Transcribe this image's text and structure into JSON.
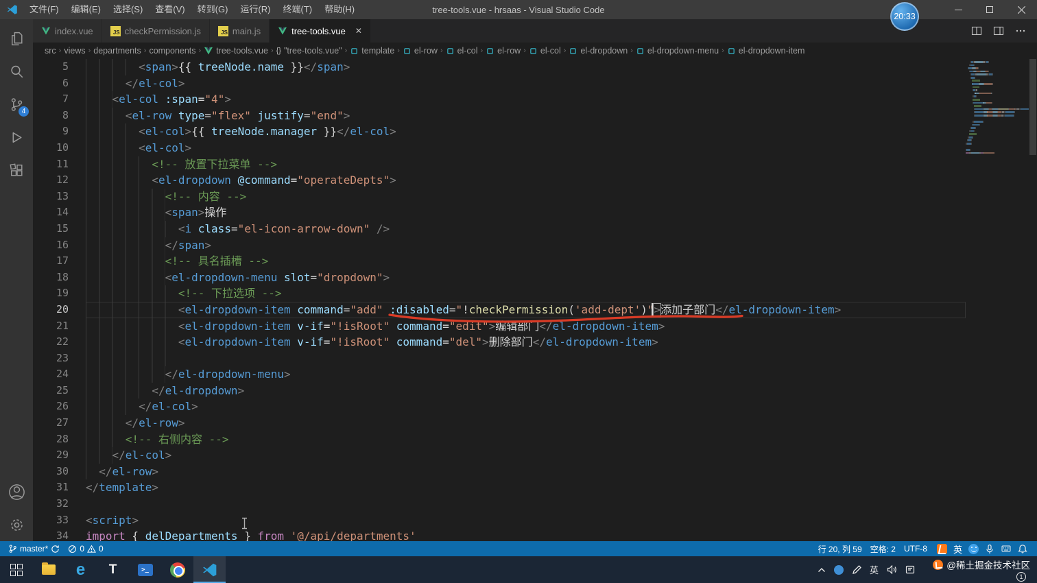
{
  "theme": {
    "titlebar": "#3c3c3c",
    "statusbar": "#0e6bab",
    "taskbar": "#1b2635",
    "tag": "#569cd6",
    "attr": "#9cdcfe",
    "string": "#ce9178",
    "comment": "#6a9955",
    "punct": "#808080",
    "keyword": "#c586c0",
    "func": "#dcdcaa",
    "text": "#d4d4d4",
    "annotation": "#d93b26"
  },
  "title_bar": {
    "menus": [
      "文件(F)",
      "编辑(E)",
      "选择(S)",
      "查看(V)",
      "转到(G)",
      "运行(R)",
      "终端(T)",
      "帮助(H)"
    ],
    "title": "tree-tools.vue - hrsaas - Visual Studio Code",
    "clock": "20:33"
  },
  "activity_bar": {
    "icons": [
      "files",
      "search",
      "source-control",
      "run-debug",
      "extensions"
    ],
    "bottom_icons": [
      "account",
      "settings"
    ],
    "source_control_badge": "4"
  },
  "tabs": [
    {
      "label": "index.vue",
      "icon": "vue",
      "active": false
    },
    {
      "label": "checkPermission.js",
      "icon": "js",
      "active": false
    },
    {
      "label": "main.js",
      "icon": "js",
      "active": false
    },
    {
      "label": "tree-tools.vue",
      "icon": "vue",
      "active": true,
      "close_glyph": "✕"
    }
  ],
  "breadcrumbs": [
    {
      "label": "src",
      "icon": ""
    },
    {
      "label": "views",
      "icon": ""
    },
    {
      "label": "departments",
      "icon": ""
    },
    {
      "label": "components",
      "icon": ""
    },
    {
      "label": "tree-tools.vue",
      "icon": "vue"
    },
    {
      "label": "\"tree-tools.vue\"",
      "icon": "braces"
    },
    {
      "label": "template",
      "icon": "element"
    },
    {
      "label": "el-row",
      "icon": "element"
    },
    {
      "label": "el-col",
      "icon": "element"
    },
    {
      "label": "el-row",
      "icon": "element"
    },
    {
      "label": "el-col",
      "icon": "element"
    },
    {
      "label": "el-dropdown",
      "icon": "element"
    },
    {
      "label": "el-dropdown-menu",
      "icon": "element"
    },
    {
      "label": "el-dropdown-item",
      "icon": "element"
    }
  ],
  "editor": {
    "lines": [
      {
        "n": 5,
        "ind": 8,
        "tk": [
          [
            "p",
            "<"
          ],
          [
            "t",
            "span"
          ],
          [
            "p",
            ">"
          ],
          [
            "x",
            "{{ "
          ],
          [
            "v",
            "treeNode.name"
          ],
          [
            "x",
            " }}"
          ],
          [
            "p",
            "</"
          ],
          [
            "t",
            "span"
          ],
          [
            "p",
            ">"
          ]
        ]
      },
      {
        "n": 6,
        "ind": 6,
        "tk": [
          [
            "p",
            "</"
          ],
          [
            "t",
            "el-col"
          ],
          [
            "p",
            ">"
          ]
        ]
      },
      {
        "n": 7,
        "ind": 4,
        "tk": [
          [
            "p",
            "<"
          ],
          [
            "t",
            "el-col"
          ],
          [
            "x",
            " "
          ],
          [
            "a",
            ":span"
          ],
          [
            "x",
            "="
          ],
          [
            "s",
            "\"4\""
          ],
          [
            "p",
            ">"
          ]
        ]
      },
      {
        "n": 8,
        "ind": 6,
        "tk": [
          [
            "p",
            "<"
          ],
          [
            "t",
            "el-row"
          ],
          [
            "x",
            " "
          ],
          [
            "a",
            "type"
          ],
          [
            "x",
            "="
          ],
          [
            "s",
            "\"flex\""
          ],
          [
            "x",
            " "
          ],
          [
            "a",
            "justify"
          ],
          [
            "x",
            "="
          ],
          [
            "s",
            "\"end\""
          ],
          [
            "p",
            ">"
          ]
        ]
      },
      {
        "n": 9,
        "ind": 8,
        "tk": [
          [
            "p",
            "<"
          ],
          [
            "t",
            "el-col"
          ],
          [
            "p",
            ">"
          ],
          [
            "x",
            "{{ "
          ],
          [
            "v",
            "treeNode.manager"
          ],
          [
            "x",
            " }}"
          ],
          [
            "p",
            "</"
          ],
          [
            "t",
            "el-col"
          ],
          [
            "p",
            ">"
          ]
        ]
      },
      {
        "n": 10,
        "ind": 8,
        "tk": [
          [
            "p",
            "<"
          ],
          [
            "t",
            "el-col"
          ],
          [
            "p",
            ">"
          ]
        ]
      },
      {
        "n": 11,
        "ind": 10,
        "tk": [
          [
            "c",
            "<!-- 放置下拉菜单 -->"
          ]
        ]
      },
      {
        "n": 12,
        "ind": 10,
        "tk": [
          [
            "p",
            "<"
          ],
          [
            "t",
            "el-dropdown"
          ],
          [
            "x",
            " "
          ],
          [
            "a",
            "@command"
          ],
          [
            "x",
            "="
          ],
          [
            "s",
            "\"operateDepts\""
          ],
          [
            "p",
            ">"
          ]
        ]
      },
      {
        "n": 13,
        "ind": 12,
        "tk": [
          [
            "c",
            "<!-- 内容 -->"
          ]
        ]
      },
      {
        "n": 14,
        "ind": 12,
        "tk": [
          [
            "p",
            "<"
          ],
          [
            "t",
            "span"
          ],
          [
            "p",
            ">"
          ],
          [
            "x",
            "操作"
          ]
        ]
      },
      {
        "n": 15,
        "ind": 14,
        "tk": [
          [
            "p",
            "<"
          ],
          [
            "t",
            "i"
          ],
          [
            "x",
            " "
          ],
          [
            "a",
            "class"
          ],
          [
            "x",
            "="
          ],
          [
            "s",
            "\"el-icon-arrow-down\""
          ],
          [
            "x",
            " "
          ],
          [
            "p",
            "/>"
          ]
        ]
      },
      {
        "n": 16,
        "ind": 12,
        "tk": [
          [
            "p",
            "</"
          ],
          [
            "t",
            "span"
          ],
          [
            "p",
            ">"
          ]
        ]
      },
      {
        "n": 17,
        "ind": 12,
        "tk": [
          [
            "c",
            "<!-- 具名插槽 -->"
          ]
        ]
      },
      {
        "n": 18,
        "ind": 12,
        "tk": [
          [
            "p",
            "<"
          ],
          [
            "t",
            "el-dropdown-menu"
          ],
          [
            "x",
            " "
          ],
          [
            "a",
            "slot"
          ],
          [
            "x",
            "="
          ],
          [
            "s",
            "\"dropdown\""
          ],
          [
            "p",
            ">"
          ]
        ]
      },
      {
        "n": 19,
        "ind": 14,
        "tk": [
          [
            "c",
            "<!-- 下拉选项 -->"
          ]
        ]
      },
      {
        "n": 20,
        "ind": 14,
        "cur": true,
        "tk": [
          [
            "p",
            "<"
          ],
          [
            "t",
            "el-dropdown-item"
          ],
          [
            "x",
            " "
          ],
          [
            "a",
            "command"
          ],
          [
            "x",
            "="
          ],
          [
            "s",
            "\"add\""
          ],
          [
            "x",
            " "
          ],
          [
            "a",
            ":disabled"
          ],
          [
            "x",
            "="
          ],
          [
            "s",
            "\""
          ],
          [
            "x",
            "!"
          ],
          [
            "f",
            "checkPermission"
          ],
          [
            "x",
            "("
          ],
          [
            "s",
            "'add-dept'"
          ],
          [
            "x",
            ")"
          ],
          [
            "s",
            "\""
          ],
          [
            "p",
            ">"
          ],
          [
            "x",
            "添加子部门"
          ],
          [
            "p",
            "</"
          ],
          [
            "t",
            "el-dropdown-item"
          ],
          [
            "p",
            ">"
          ]
        ]
      },
      {
        "n": 21,
        "ind": 14,
        "tk": [
          [
            "p",
            "<"
          ],
          [
            "t",
            "el-dropdown-item"
          ],
          [
            "x",
            " "
          ],
          [
            "a",
            "v-if"
          ],
          [
            "x",
            "="
          ],
          [
            "s",
            "\"!isRoot\""
          ],
          [
            "x",
            " "
          ],
          [
            "a",
            "command"
          ],
          [
            "x",
            "="
          ],
          [
            "s",
            "\"edit\""
          ],
          [
            "p",
            ">"
          ],
          [
            "x",
            "编辑部门"
          ],
          [
            "p",
            "</"
          ],
          [
            "t",
            "el-dropdown-item"
          ],
          [
            "p",
            ">"
          ]
        ]
      },
      {
        "n": 22,
        "ind": 14,
        "tk": [
          [
            "p",
            "<"
          ],
          [
            "t",
            "el-dropdown-item"
          ],
          [
            "x",
            " "
          ],
          [
            "a",
            "v-if"
          ],
          [
            "x",
            "="
          ],
          [
            "s",
            "\"!isRoot\""
          ],
          [
            "x",
            " "
          ],
          [
            "a",
            "command"
          ],
          [
            "x",
            "="
          ],
          [
            "s",
            "\"del\""
          ],
          [
            "p",
            ">"
          ],
          [
            "x",
            "删除部门"
          ],
          [
            "p",
            "</"
          ],
          [
            "t",
            "el-dropdown-item"
          ],
          [
            "p",
            ">"
          ]
        ]
      },
      {
        "n": 23,
        "ind": 14,
        "tk": []
      },
      {
        "n": 24,
        "ind": 12,
        "tk": [
          [
            "p",
            "</"
          ],
          [
            "t",
            "el-dropdown-menu"
          ],
          [
            "p",
            ">"
          ]
        ]
      },
      {
        "n": 25,
        "ind": 10,
        "tk": [
          [
            "p",
            "</"
          ],
          [
            "t",
            "el-dropdown"
          ],
          [
            "p",
            ">"
          ]
        ]
      },
      {
        "n": 26,
        "ind": 8,
        "tk": [
          [
            "p",
            "</"
          ],
          [
            "t",
            "el-col"
          ],
          [
            "p",
            ">"
          ]
        ]
      },
      {
        "n": 27,
        "ind": 6,
        "tk": [
          [
            "p",
            "</"
          ],
          [
            "t",
            "el-row"
          ],
          [
            "p",
            ">"
          ]
        ]
      },
      {
        "n": 28,
        "ind": 6,
        "tk": [
          [
            "c",
            "<!-- 右侧内容 -->"
          ]
        ]
      },
      {
        "n": 29,
        "ind": 4,
        "tk": [
          [
            "p",
            "</"
          ],
          [
            "t",
            "el-col"
          ],
          [
            "p",
            ">"
          ]
        ]
      },
      {
        "n": 30,
        "ind": 2,
        "tk": [
          [
            "p",
            "</"
          ],
          [
            "t",
            "el-row"
          ],
          [
            "p",
            ">"
          ]
        ]
      },
      {
        "n": 31,
        "ind": 0,
        "tk": [
          [
            "p",
            "</"
          ],
          [
            "t",
            "template"
          ],
          [
            "p",
            ">"
          ]
        ]
      },
      {
        "n": 32,
        "ind": 0,
        "tk": []
      },
      {
        "n": 33,
        "ind": 0,
        "tk": [
          [
            "p",
            "<"
          ],
          [
            "t",
            "script"
          ],
          [
            "p",
            ">"
          ]
        ]
      },
      {
        "n": 34,
        "ind": 0,
        "tk": [
          [
            "k",
            "import"
          ],
          [
            "x",
            " { "
          ],
          [
            "v",
            "delDepartments"
          ],
          [
            "x",
            " } "
          ],
          [
            "k",
            "from"
          ],
          [
            "x",
            " "
          ],
          [
            "s",
            "'@/api/departments'"
          ]
        ]
      }
    ]
  },
  "status_bar": {
    "branch": "master*",
    "errors": "0",
    "warnings": "0",
    "line_col": "行 20, 列 59",
    "indent": "空格: 2",
    "encoding": "UTF-8",
    "ime": "英",
    "icons": [
      "juejin-logo",
      "ime-indicator",
      "smiley",
      "mic",
      "keyboard",
      "bell"
    ]
  },
  "taskbar": {
    "apps": [
      "start",
      "file-explorer",
      "edge",
      "t-app",
      "powershell",
      "chrome",
      "vscode"
    ],
    "active_app": "vscode",
    "edge_glyph": "e",
    "t_glyph": "T",
    "tray_ime": "英",
    "tray_badge": "1",
    "watermark": "@稀土掘金技术社区"
  }
}
